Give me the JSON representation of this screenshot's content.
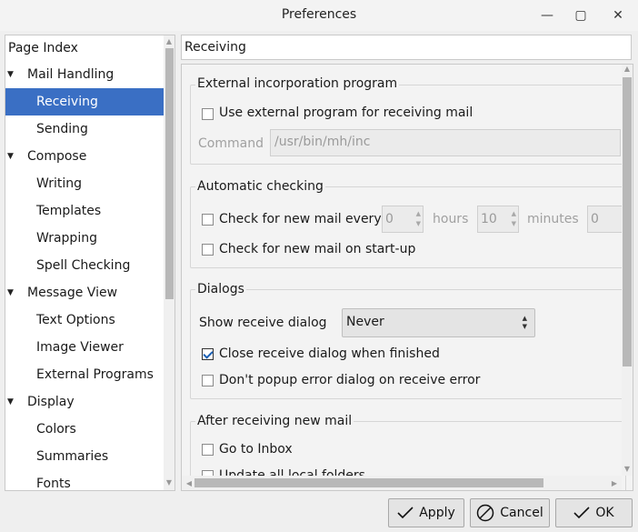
{
  "window": {
    "title": "Preferences",
    "minimize_glyph": "—",
    "maximize_glyph": "▢",
    "close_glyph": "✕"
  },
  "tree": {
    "header": "Page Index",
    "items": [
      {
        "label": "Mail Handling",
        "level": 0,
        "expanded": true
      },
      {
        "label": "Receiving",
        "level": 1,
        "selected": true
      },
      {
        "label": "Sending",
        "level": 1
      },
      {
        "label": "Compose",
        "level": 0,
        "expanded": true
      },
      {
        "label": "Writing",
        "level": 1
      },
      {
        "label": "Templates",
        "level": 1
      },
      {
        "label": "Wrapping",
        "level": 1
      },
      {
        "label": "Spell Checking",
        "level": 1
      },
      {
        "label": "Message View",
        "level": 0,
        "expanded": true
      },
      {
        "label": "Text Options",
        "level": 1
      },
      {
        "label": "Image Viewer",
        "level": 1
      },
      {
        "label": "External Programs",
        "level": 1
      },
      {
        "label": "Display",
        "level": 0,
        "expanded": true
      },
      {
        "label": "Colors",
        "level": 1
      },
      {
        "label": "Summaries",
        "level": 1
      },
      {
        "label": "Fonts",
        "level": 1
      }
    ]
  },
  "page": {
    "title": "Receiving",
    "external": {
      "title": "External incorporation program",
      "use_external_label": "Use external program for receiving mail",
      "use_external_checked": false,
      "command_label": "Command",
      "command_value": "/usr/bin/mh/inc"
    },
    "automatic": {
      "title": "Automatic checking",
      "check_every_label": "Check for new mail every",
      "check_every_checked": false,
      "hours_value": "0",
      "hours_label": "hours",
      "minutes_value": "10",
      "minutes_label": "minutes",
      "seconds_value": "0",
      "startup_label": "Check for new mail on start-up",
      "startup_checked": false
    },
    "dialogs": {
      "title": "Dialogs",
      "show_receive_label": "Show receive dialog",
      "show_receive_value": "Never",
      "close_when_finished_label": "Close receive dialog when finished",
      "close_when_finished_checked": true,
      "no_popup_error_label": "Don't popup error dialog on receive error",
      "no_popup_error_checked": false
    },
    "after": {
      "title": "After receiving new mail",
      "go_inbox_label": "Go to Inbox",
      "go_inbox_checked": false,
      "update_all_label": "Update all local folders",
      "update_all_checked": false
    }
  },
  "buttons": {
    "apply": {
      "label": "Apply",
      "icon": "check-icon"
    },
    "cancel": {
      "label": "Cancel",
      "icon": "cancel-icon"
    },
    "ok": {
      "label": "OK",
      "icon": "check-icon"
    }
  }
}
